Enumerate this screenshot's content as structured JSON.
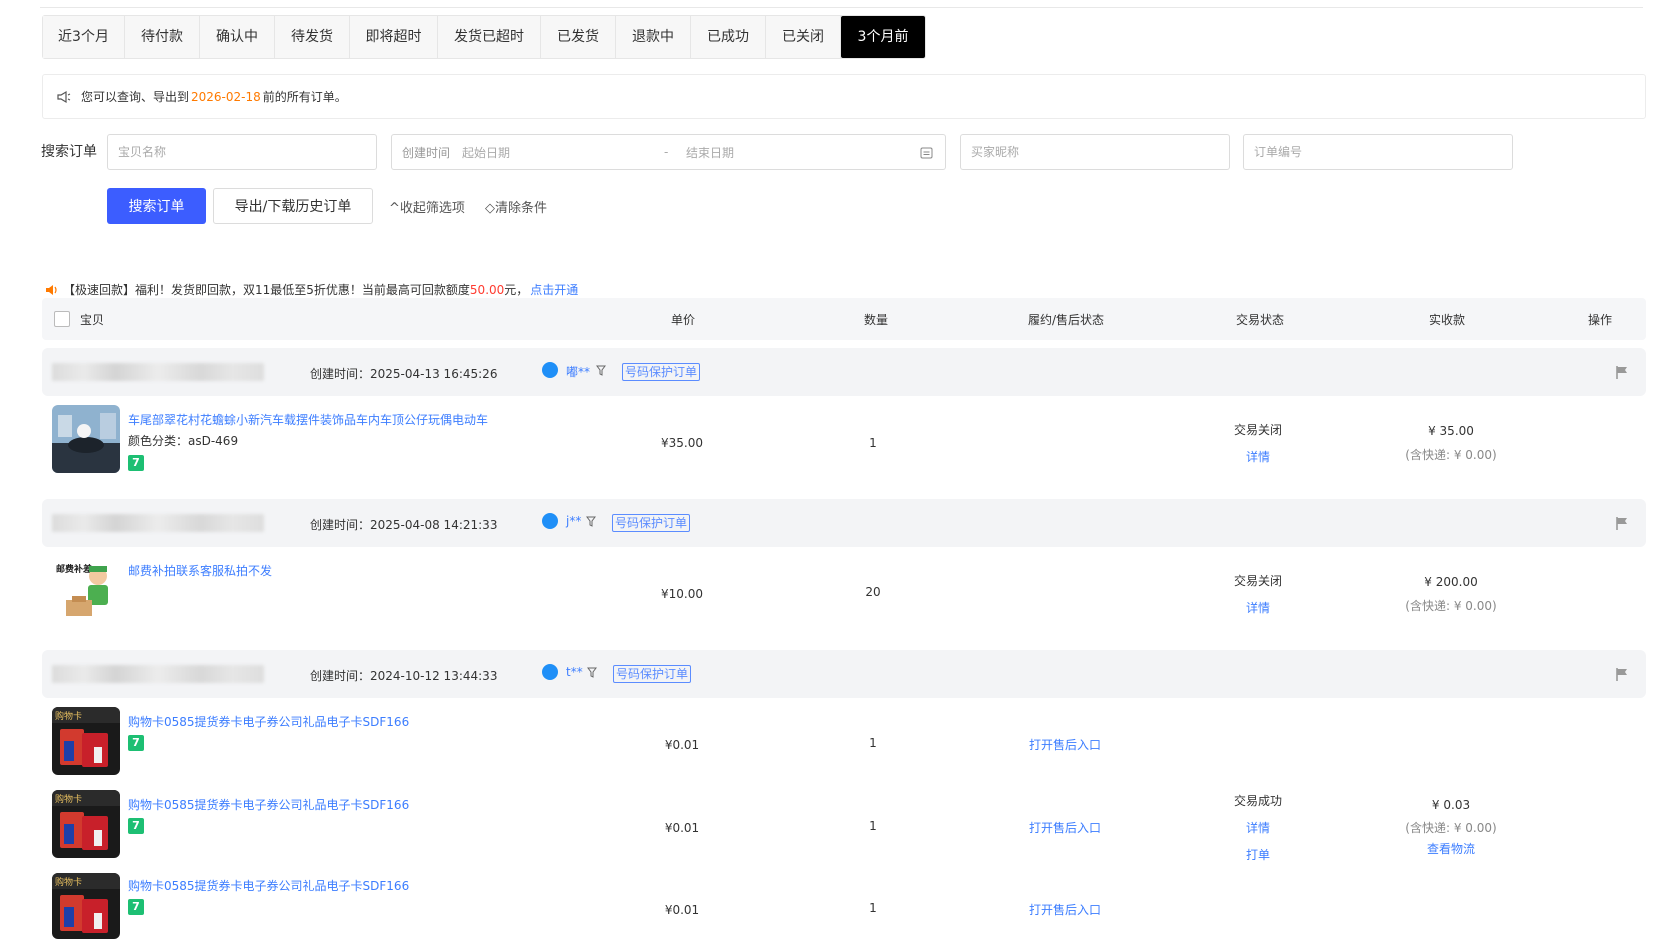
{
  "tabs": [
    "近3个月",
    "待付款",
    "确认中",
    "待发货",
    "即将超时",
    "发货已超时",
    "已发货",
    "退款中",
    "已成功",
    "已关闭",
    "3个月前"
  ],
  "notice": {
    "prefix": "您可以查询、导出到",
    "date": "2026-02-18",
    "suffix": "前的所有订单。"
  },
  "search": {
    "label": "搜索订单",
    "item_placeholder": "宝贝名称",
    "created_label": "创建时间",
    "start_placeholder": "起始日期",
    "sep": "-",
    "end_placeholder": "结束日期",
    "buyer_placeholder": "买家昵称",
    "order_placeholder": "订单编号",
    "search_btn": "搜索订单",
    "export_btn": "导出/下载历史订单",
    "collapse": "收起筛选项",
    "clear": "清除条件"
  },
  "promo": {
    "text1": "【极速回款】福利！发货即回款，双11最低至5折优惠！当前最高可回款额度",
    "amount": "50.00",
    "text2": "元，",
    "link": "点击开通"
  },
  "columns": {
    "item": "宝贝",
    "price": "单价",
    "qty": "数量",
    "fulfill": "履约/售后状态",
    "status": "交易状态",
    "paid": "实收款",
    "action": "操作"
  },
  "orders": [
    {
      "created": "创建时间：2025-04-13 16:45:26",
      "buyer": "嘟**",
      "tag": "号码保护订单",
      "items": [
        {
          "title": "车尾部翠花村花蟾蜍小新汽车载摆件装饰品车内车顶公仔玩偶电动车",
          "sku": "颜色分类：asD-469",
          "price": "¥35.00",
          "qty": "1",
          "after": ""
        }
      ],
      "status": "交易关闭",
      "detail": "详情",
      "paid": "¥ 35.00",
      "ship": "(含快递: ¥ 0.00)"
    },
    {
      "created": "创建时间：2025-04-08 14:21:33",
      "buyer": "j**",
      "tag": "号码保护订单",
      "items": [
        {
          "title": "邮费补拍联系客服私拍不发",
          "sku": "",
          "price": "¥10.00",
          "qty": "20",
          "after": ""
        }
      ],
      "status": "交易关闭",
      "detail": "详情",
      "paid": "¥ 200.00",
      "ship": "(含快递: ¥ 0.00)"
    },
    {
      "created": "创建时间：2024-10-12 13:44:33",
      "buyer": "t**",
      "tag": "号码保护订单",
      "items": [
        {
          "title": "购物卡0585提货券卡电子券公司礼品电子卡SDF166",
          "sku": "",
          "price": "¥0.01",
          "qty": "1",
          "after": "打开售后入口"
        },
        {
          "title": "购物卡0585提货券卡电子券公司礼品电子卡SDF166",
          "sku": "",
          "price": "¥0.01",
          "qty": "1",
          "after": "打开售后入口"
        },
        {
          "title": "购物卡0585提货券卡电子券公司礼品电子卡SDF166",
          "sku": "",
          "price": "¥0.01",
          "qty": "1",
          "after": "打开售后入口"
        }
      ],
      "status": "交易成功",
      "detail": "详情",
      "print": "打单",
      "paid": "¥ 0.03",
      "ship": "(含快递: ¥ 0.00)",
      "logistics": "查看物流"
    }
  ],
  "badge_text": "7",
  "colors": {
    "primary": "#3c5dff",
    "link": "#3c7dff",
    "orange": "#ff7a00",
    "red": "#ff3b30",
    "tabActive": "#000000"
  }
}
